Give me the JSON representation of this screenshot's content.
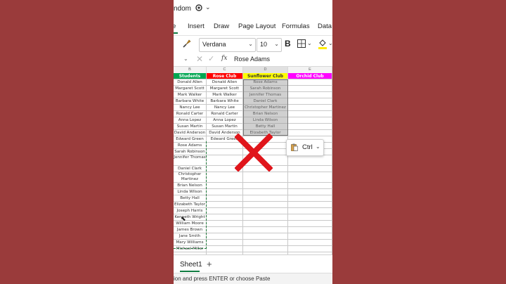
{
  "title": {
    "text": "ndom",
    "chevron": "⌄"
  },
  "tabs": [
    "e",
    "Insert",
    "Draw",
    "Page Layout",
    "Formulas",
    "Data"
  ],
  "toolbar": {
    "font_name": "Verdana",
    "font_size": "10",
    "bold_label": "B",
    "chevron": "⌄"
  },
  "formula_bar": {
    "cancel": "✕",
    "enter": "✓",
    "fx": "fx",
    "value": "Rose Adams"
  },
  "columns": [
    "B",
    "C",
    "D",
    "E"
  ],
  "headers": {
    "b": "Students",
    "c": "Rose Club",
    "d": "Sunflower Club",
    "e": "Orchid Club"
  },
  "header_colors": {
    "b": "#00a651",
    "c": "#ff0000",
    "d": "#ffff00",
    "e": "#ff00ff"
  },
  "rows": [
    {
      "b": "Donald Allen",
      "c": "Donald Allen",
      "d": "Rose Adams"
    },
    {
      "b": "Margaret Scott",
      "c": "Margaret Scott",
      "d": "Sarah Robinson"
    },
    {
      "b": "Mark Walker",
      "c": "Mark Walker",
      "d": "Jennifer Thomas"
    },
    {
      "b": "Barbara White",
      "c": "Barbara White",
      "d": "Daniel Clark"
    },
    {
      "b": "Nancy Lee",
      "c": "Nancy Lee",
      "d": "Christopher Martinez"
    },
    {
      "b": "Ronald Carter",
      "c": "Ronald Carter",
      "d": "Brian Nelson"
    },
    {
      "b": "Anna Lopez",
      "c": "Anna Lopez",
      "d": "Linda Wilson"
    },
    {
      "b": "Susan Martin",
      "c": "Susan Martin",
      "d": "Betty Hall"
    },
    {
      "b": "David Anderson",
      "c": "David Anderson",
      "d": "Elizabeth Taylor"
    },
    {
      "b": "Edward Green",
      "c": "Edward Green",
      "d": ""
    },
    {
      "b": "Rose Adams",
      "c": "",
      "d": ""
    },
    {
      "b": "Sarah Robinson",
      "c": "",
      "d": ""
    },
    {
      "b": "Jennifer Thomas",
      "c": "",
      "d": "",
      "tall": true
    },
    {
      "b": "Daniel Clark",
      "c": "",
      "d": ""
    },
    {
      "b": "Christopher Martinez",
      "c": "",
      "d": "",
      "tall": true
    },
    {
      "b": "Brian Nelson",
      "c": "",
      "d": ""
    },
    {
      "b": "Linda Wilson",
      "c": "",
      "d": ""
    },
    {
      "b": "Betty Hall",
      "c": "",
      "d": ""
    },
    {
      "b": "Elizabeth Taylor",
      "c": "",
      "d": ""
    },
    {
      "b": "Joseph Harris",
      "c": "",
      "d": ""
    },
    {
      "b": "Kenneth Wright",
      "c": "",
      "d": ""
    },
    {
      "b": "William Moore",
      "c": "",
      "d": ""
    },
    {
      "b": "James Brown",
      "c": "",
      "d": ""
    },
    {
      "b": "Jane Smith",
      "c": "",
      "d": ""
    },
    {
      "b": "Mary Williams",
      "c": "",
      "d": ""
    },
    {
      "b": "Michael Miller",
      "c": "",
      "d": ""
    }
  ],
  "paste_popover": {
    "label": "Ctrl",
    "chevron": "⌄",
    "icon": "clipboard-icon"
  },
  "sheet": {
    "name": "Sheet1",
    "add": "+"
  },
  "status": "ion and press ENTER or choose Paste",
  "overlay": {
    "big_x_color": "#e0151b",
    "icon": "big-x-icon"
  }
}
